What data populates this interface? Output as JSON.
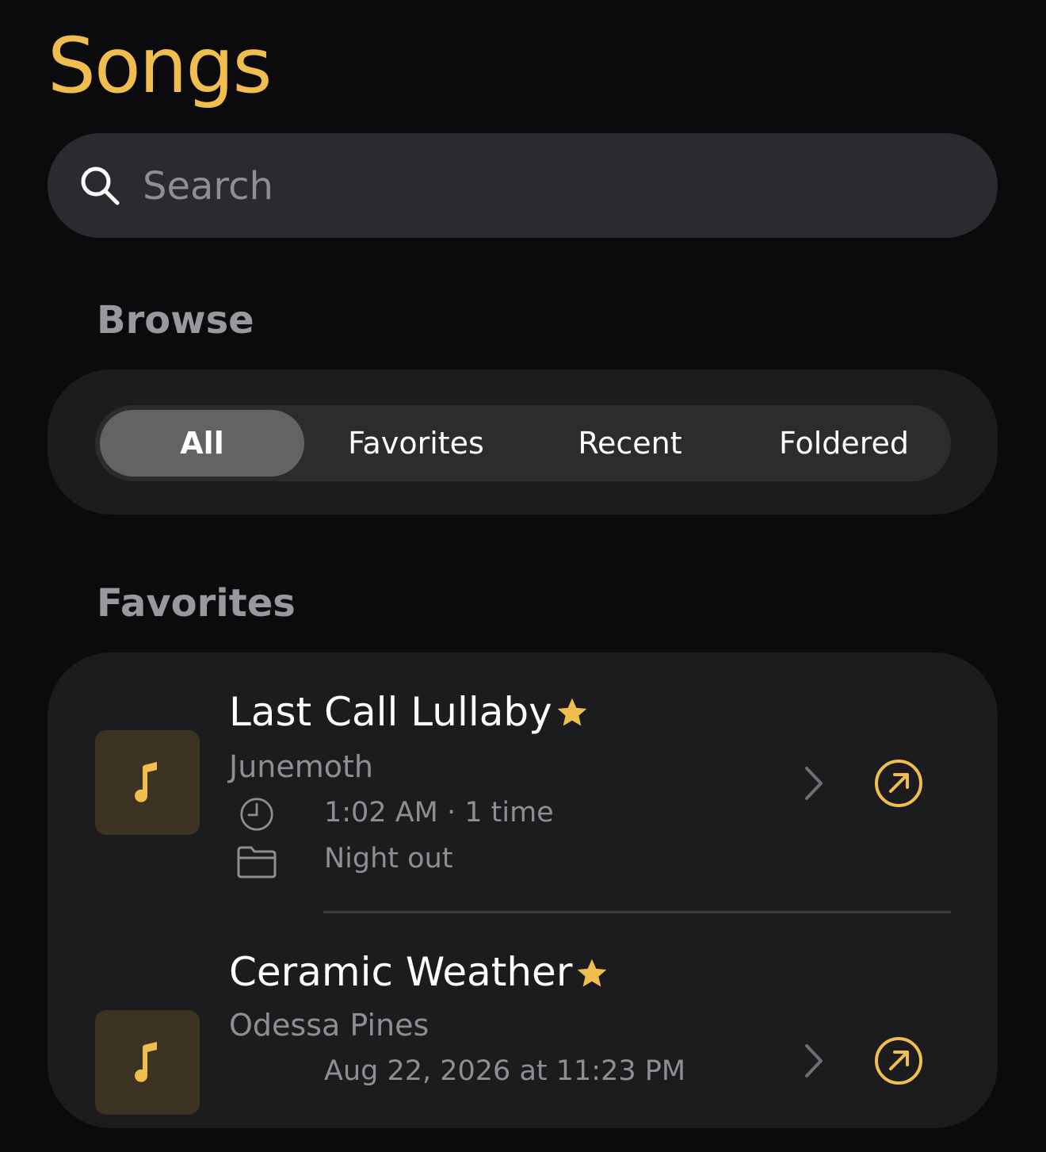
{
  "header": {
    "title": "Songs"
  },
  "search": {
    "placeholder": "Search"
  },
  "browse": {
    "title": "Browse",
    "segments": [
      {
        "label": "All",
        "selected": true
      },
      {
        "label": "Favorites",
        "selected": false
      },
      {
        "label": "Recent",
        "selected": false
      },
      {
        "label": "Foldered",
        "selected": false
      }
    ]
  },
  "favorites": {
    "title": "Favorites",
    "items": [
      {
        "title": "Last Call Lullaby",
        "artist": "Junemoth",
        "played": "1:02 AM · 1 time",
        "folder": "Night out",
        "favorite": true
      },
      {
        "title": "Ceramic Weather",
        "artist": "Odessa Pines",
        "played": "Aug 22, 2026 at 11:23 PM",
        "favorite": true
      }
    ]
  },
  "colors": {
    "accent": "#f0bd4f",
    "background": "#0b0b0d",
    "card": "#1c1c1e",
    "secondary_text": "#8e8e93",
    "artwork_bg": "#3d3322"
  }
}
